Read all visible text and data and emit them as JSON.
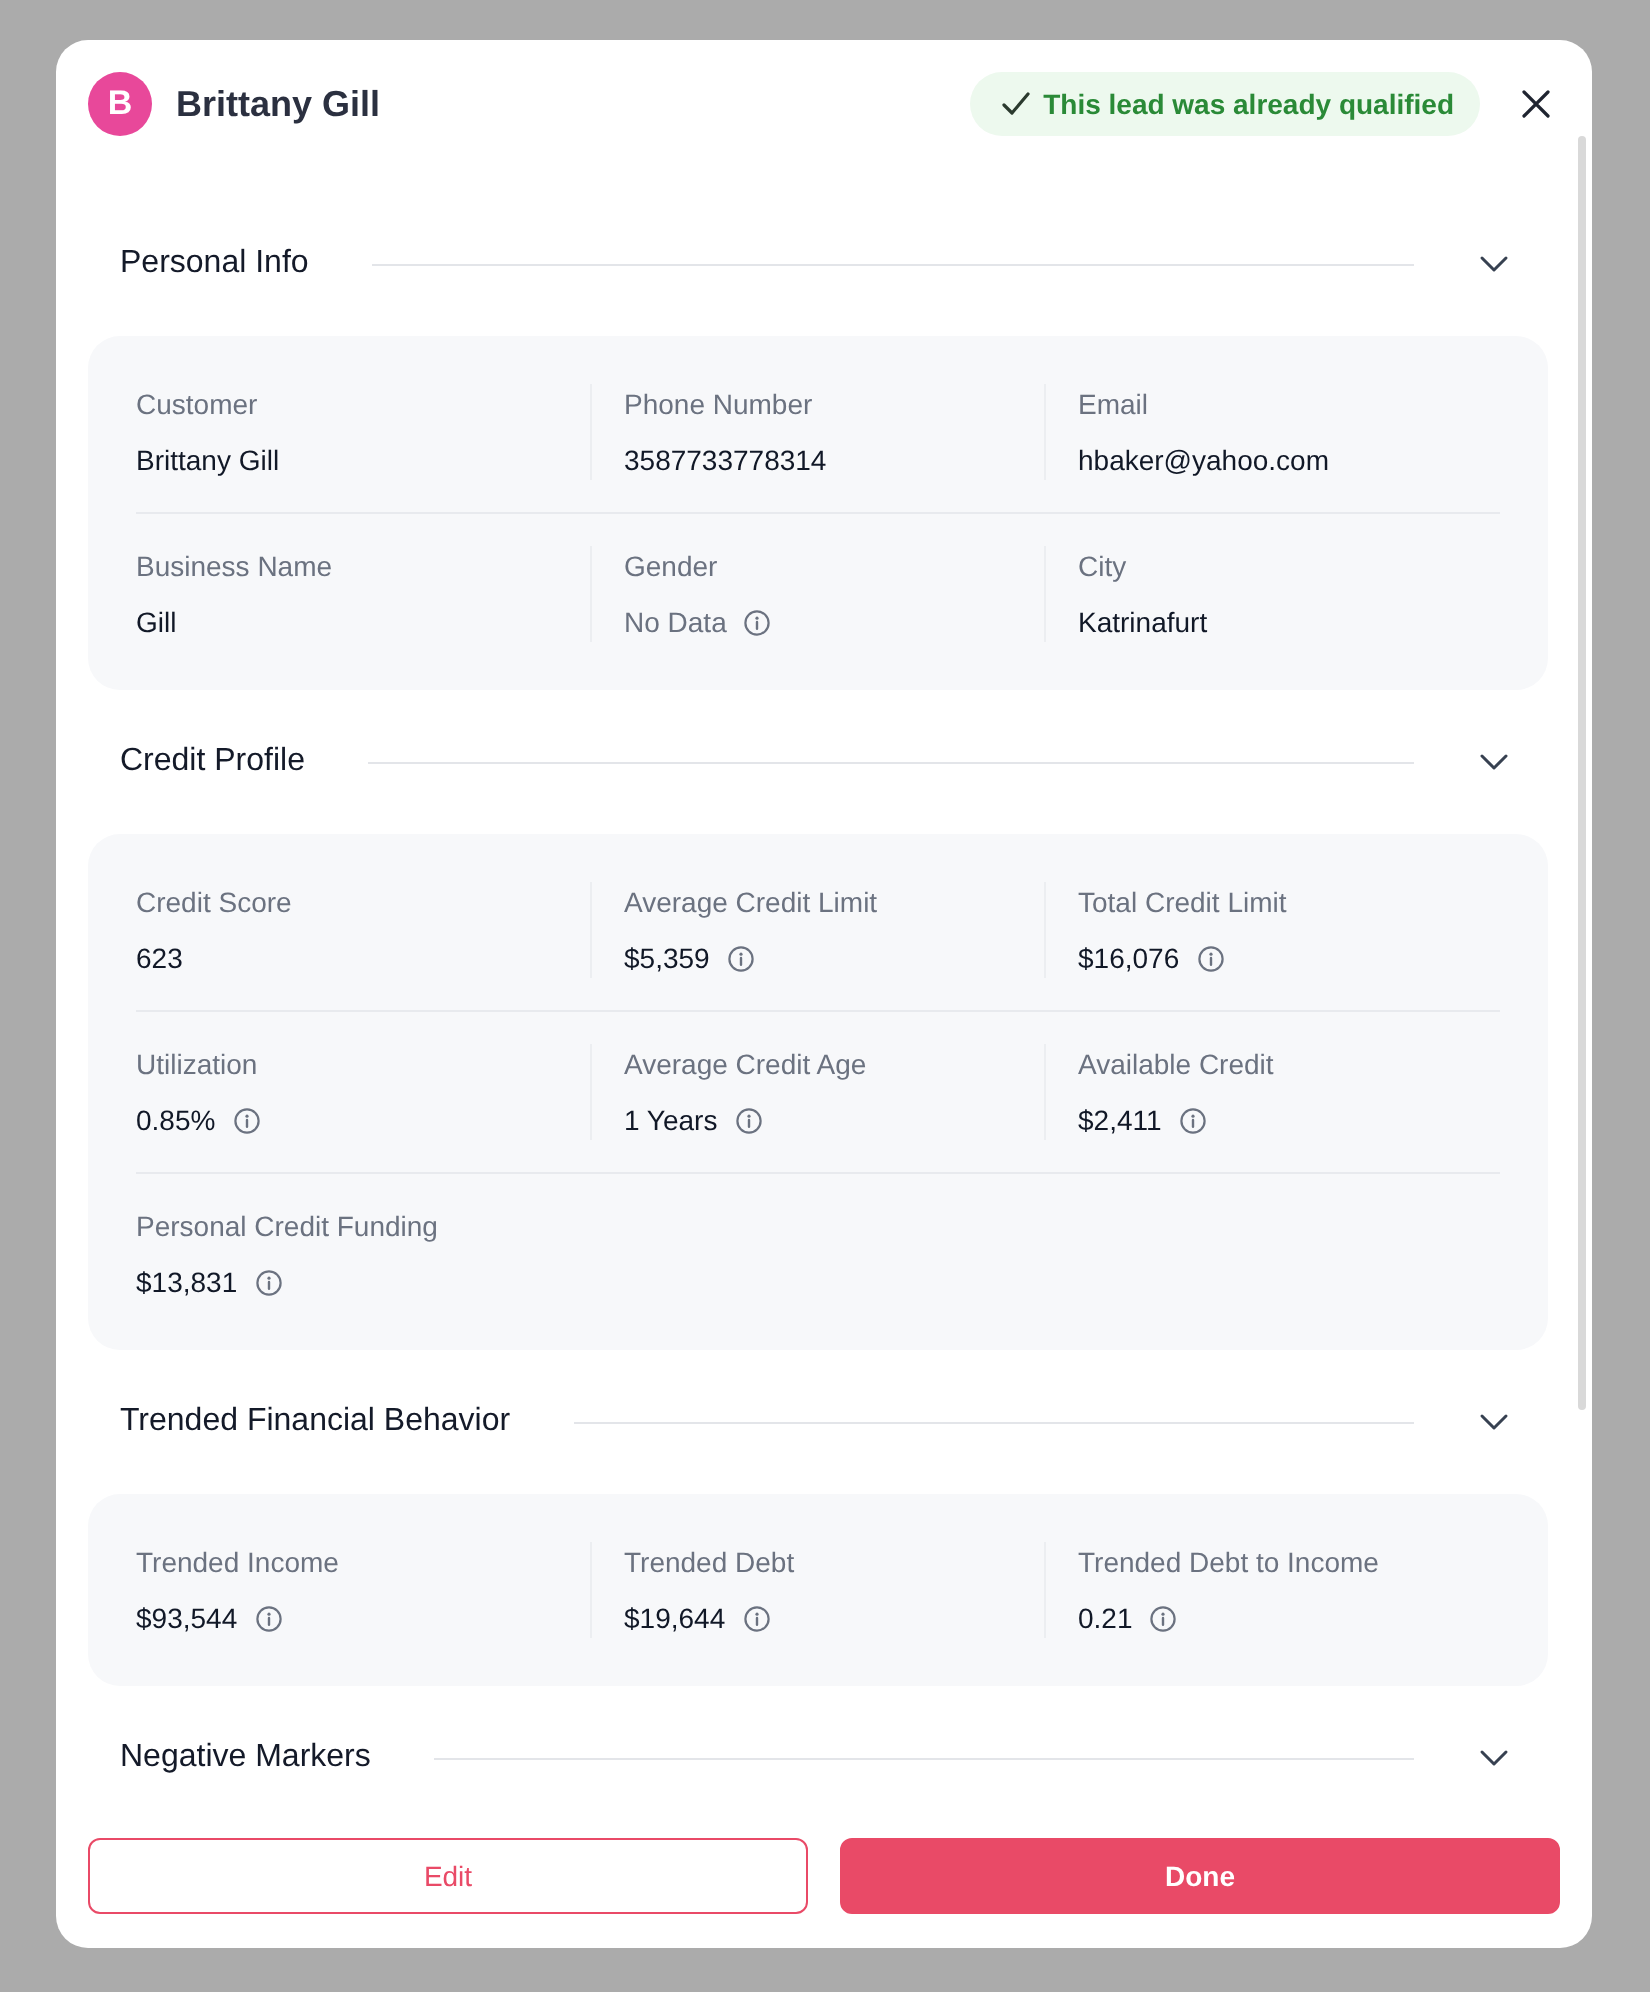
{
  "modal": {
    "avatar_initial": "B",
    "title": "Brittany Gill",
    "status_badge": {
      "kind": "success",
      "text": "This lead was already qualified"
    }
  },
  "sections": [
    {
      "title": "Personal Info",
      "expanded": true,
      "rows": [
        [
          {
            "label": "Customer",
            "value": "Brittany Gill",
            "info": false,
            "no_data": false
          },
          {
            "label": "Phone Number",
            "value": "3587733778314",
            "info": false,
            "no_data": false
          },
          {
            "label": "Email",
            "value": "hbaker@yahoo.com",
            "info": false,
            "no_data": false
          }
        ],
        [
          {
            "label": "Business Name",
            "value": "Gill",
            "info": false,
            "no_data": false
          },
          {
            "label": "Gender",
            "value": "No Data",
            "info": true,
            "no_data": true
          },
          {
            "label": "City",
            "value": "Katrinafurt",
            "info": false,
            "no_data": false
          }
        ]
      ]
    },
    {
      "title": "Credit Profile",
      "expanded": true,
      "rows": [
        [
          {
            "label": "Credit Score",
            "value": "623",
            "info": false,
            "no_data": false
          },
          {
            "label": "Average Credit Limit",
            "value": "$5,359",
            "info": true,
            "no_data": false
          },
          {
            "label": "Total Credit Limit",
            "value": "$16,076",
            "info": true,
            "no_data": false
          }
        ],
        [
          {
            "label": "Utilization",
            "value": "0.85%",
            "info": true,
            "no_data": false
          },
          {
            "label": "Average Credit Age",
            "value": "1 Years",
            "info": true,
            "no_data": false
          },
          {
            "label": "Available Credit",
            "value": "$2,411",
            "info": true,
            "no_data": false
          }
        ],
        [
          {
            "label": "Personal Credit Funding",
            "value": "$13,831",
            "info": true,
            "no_data": false
          }
        ]
      ]
    },
    {
      "title": "Trended Financial Behavior",
      "expanded": true,
      "rows": [
        [
          {
            "label": "Trended Income",
            "value": "$93,544",
            "info": true,
            "no_data": false
          },
          {
            "label": "Trended Debt",
            "value": "$19,644",
            "info": true,
            "no_data": false
          },
          {
            "label": "Trended Debt to Income",
            "value": "0.21",
            "info": true,
            "no_data": false
          }
        ]
      ]
    },
    {
      "title": "Negative Markers",
      "expanded": true
    }
  ],
  "footer": {
    "buttons": [
      {
        "label": "Edit",
        "kind": "secondary"
      },
      {
        "label": "Done",
        "kind": "primary"
      }
    ]
  }
}
